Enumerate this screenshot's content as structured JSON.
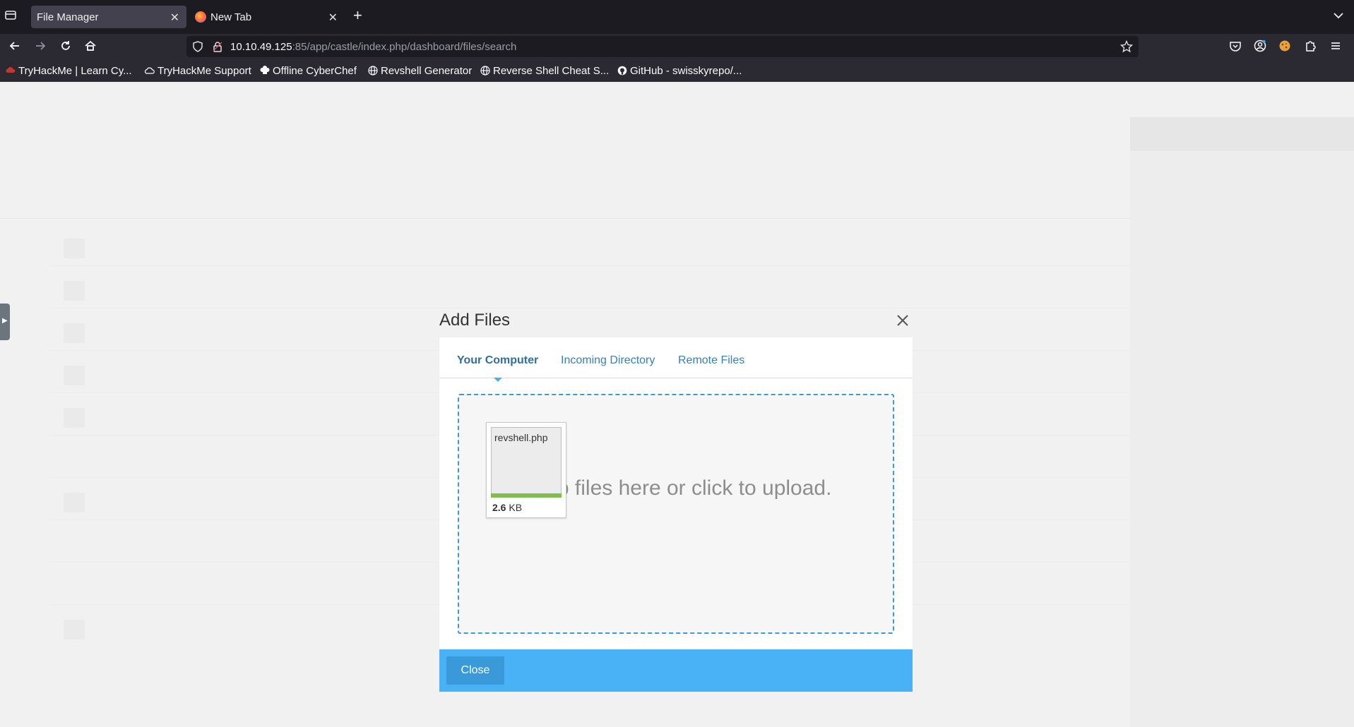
{
  "browser": {
    "tabs": [
      {
        "title": "File Manager",
        "active": true
      },
      {
        "title": "New Tab",
        "active": false
      }
    ],
    "url": {
      "host": "10.10.49.125",
      "rest": ":85/app/castle/index.php/dashboard/files/search"
    },
    "bookmarks": [
      {
        "label": "TryHackMe | Learn Cy...",
        "icon": "tryhackme-icon"
      },
      {
        "label": "TryHackMe Support",
        "icon": "cloud-icon"
      },
      {
        "label": "Offline CyberChef",
        "icon": "chef-hat-icon"
      },
      {
        "label": "Revshell Generator",
        "icon": "globe-icon"
      },
      {
        "label": "Reverse Shell Cheat S...",
        "icon": "globe-icon"
      },
      {
        "label": "GitHub - swisskyrepo/...",
        "icon": "github-icon"
      }
    ]
  },
  "modal": {
    "title": "Add Files",
    "tabs": [
      "Your Computer",
      "Incoming Directory",
      "Remote Files"
    ],
    "dropzone_message": "Drop files here or click to upload.",
    "file": {
      "name": "revshell.php",
      "size_value": "2.6",
      "size_unit": "KB",
      "progress": 1.0
    },
    "close_label": "Close"
  },
  "colors": {
    "accent": "#49b1f5",
    "link": "#3a7fb8",
    "progress": "#7dbf4e"
  }
}
